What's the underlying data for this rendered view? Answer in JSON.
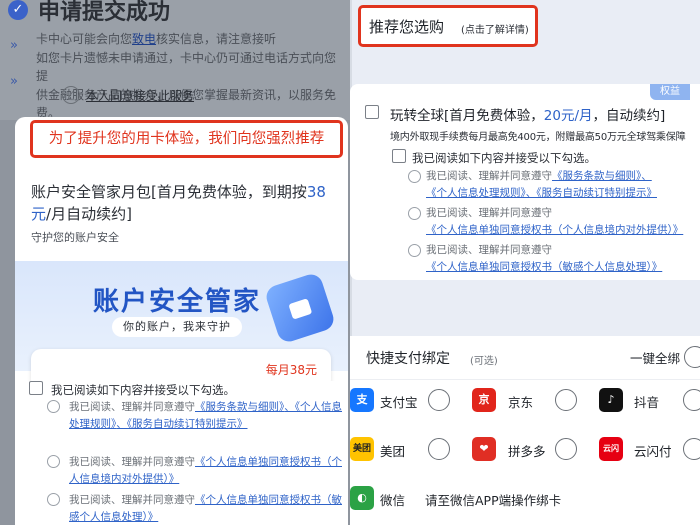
{
  "left": {
    "title": "申请提交成功",
    "desc_line1_a": "卡中心可能会向您",
    "desc_line1_link": "致电",
    "desc_line1_b": "核实信息，请注意接听",
    "desc_line2": "如您卡片遗憾未申请通过，卡中心仍可通过电话方式向您提",
    "desc_line3": "供金融服务产品的推介，以便您掌握最新资讯，以服务免",
    "desc_line4": "费。",
    "agree_text": "本人同意接受此服务",
    "popup": {
      "banner": "为了提升您的用卡体验，我们向您强烈推荐",
      "title_a": "账户安全管家月包[首月免费体验，到期按",
      "title_price": "38",
      "title_b": "元",
      "title_c": "/月自动续约]",
      "subtitle": "守护您的账户安全",
      "hero_title": "账户安全管家",
      "hero_slogan": "你的账户，我来守护",
      "card_price": "每月38元",
      "agree_main": "我已阅读如下内容并接受以下勾选。",
      "agree_items": [
        {
          "prefix": "我已阅读、理解并同意遵守",
          "links": [
            "《服务条款与细则》",
            "、《个人信息处理规则》",
            "、《服务自动续订特别提示》"
          ]
        },
        {
          "prefix": "我已阅读、理解并同意遵守",
          "links": [
            "《个人信息单独同意授权书（个人信息境内对外提供）》"
          ]
        },
        {
          "prefix": "我已阅读、理解并同意遵守",
          "links": [
            "《个人信息单独同意授权书（敏感个人信息处理）》"
          ]
        }
      ]
    }
  },
  "right": {
    "banner_title": "推荐您选购",
    "banner_sub": "(点击了解详情)",
    "offer": {
      "tag": "权益",
      "title_a": "玩转全球[首月免费体验，",
      "title_price": "20元/月",
      "title_b": "，自动续约]",
      "desc": "境内外取现手续费每月最高免400元，附赠最高50万元全球驾乘保障",
      "agree_main": "我已阅读如下内容并接受以下勾选。",
      "items": [
        {
          "prefix": "我已阅读、理解并同意遵守",
          "line1_links": "《服务条款与细则》、",
          "line2_links": "《个人信息处理规则》、《服务自动续订特别提示》"
        },
        {
          "prefix": "我已阅读、理解并同意遵守",
          "line2_links": "《个人信息单独同意授权书（个人信息境内对外提供）》"
        },
        {
          "prefix": "我已阅读、理解并同意遵守",
          "line2_links": "《个人信息单独同意授权书（敏感个人信息处理）》"
        }
      ]
    },
    "paybind": {
      "title": "快捷支付绑定",
      "sub": "(可选)",
      "bind_all": "一键全绑",
      "items": [
        {
          "label": "支付宝",
          "icon": "alipay-icon",
          "color": "#1677ff"
        },
        {
          "label": "京东",
          "icon": "jd-icon",
          "color": "#e1251b"
        },
        {
          "label": "抖音",
          "icon": "douyin-icon",
          "color": "#111111"
        },
        {
          "label": "美团",
          "icon": "meituan-icon",
          "color": "#ffc300"
        },
        {
          "label": "拼多多",
          "icon": "pinduoduo-icon",
          "color": "#e02e24"
        },
        {
          "label": "云闪付",
          "icon": "unionpay-icon",
          "color": "#e60012"
        },
        {
          "label": "微信",
          "icon": "wechat-icon",
          "color": "#2ba245"
        }
      ],
      "wechat_note": "请至微信APP端操作绑卡"
    }
  }
}
